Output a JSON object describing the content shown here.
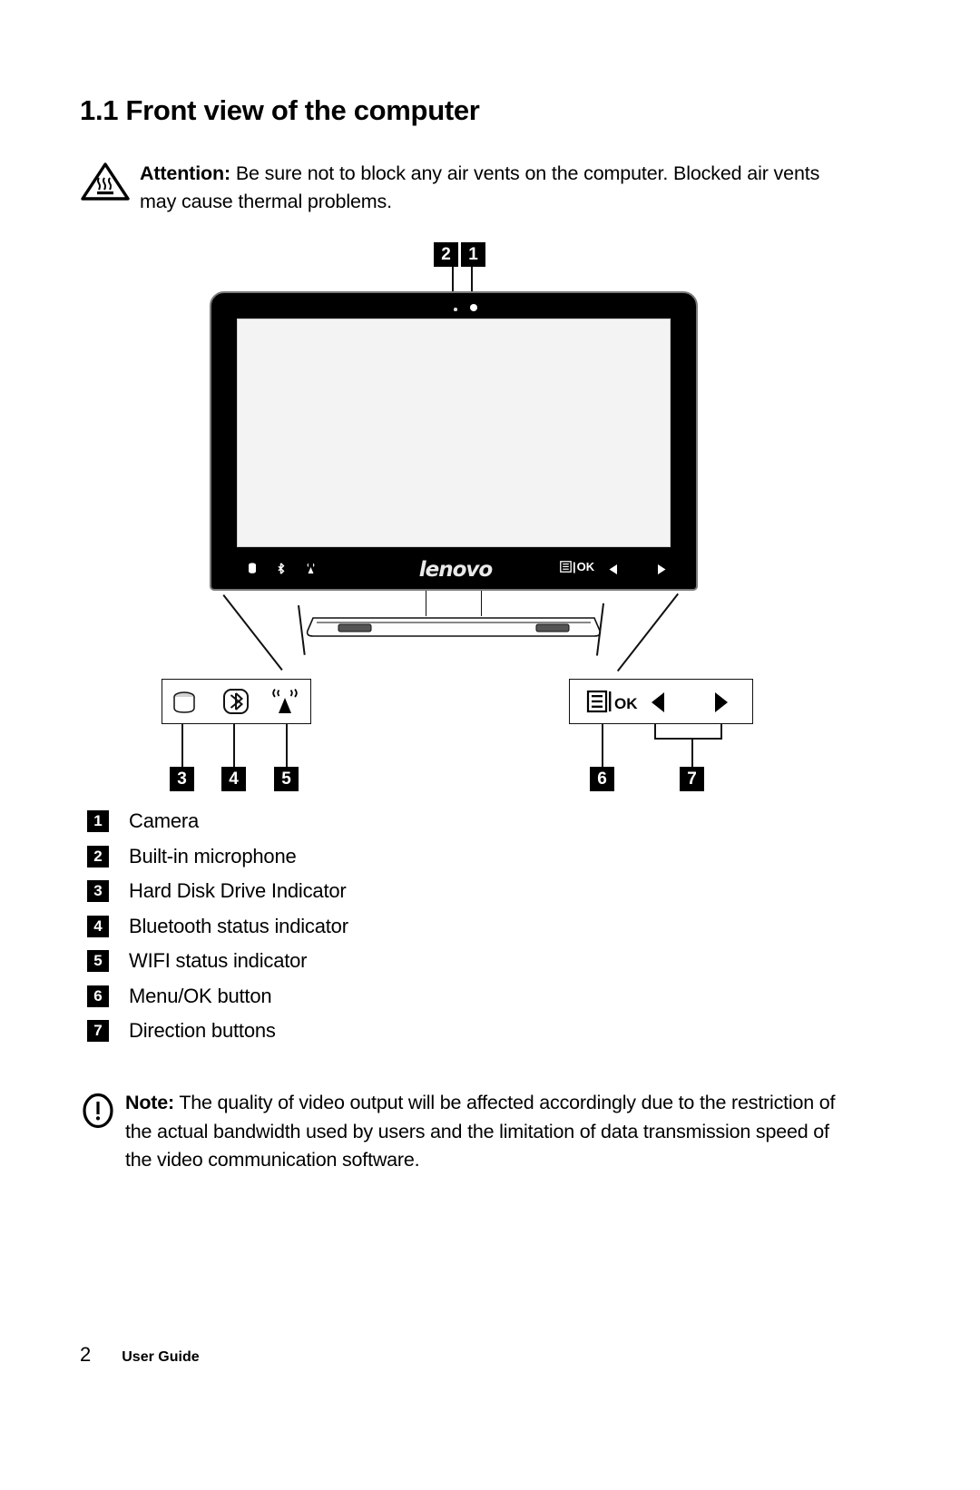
{
  "heading": "1.1 Front view of the computer",
  "attention": {
    "icon": "hot-surface-warning-icon",
    "label": "Attention:",
    "body": " Be sure not to block any air vents on the computer. Blocked air vents may cause thermal problems."
  },
  "diagram": {
    "brand_logo": "lenovo",
    "callouts": {
      "c1": "1",
      "c2": "2",
      "c3": "3",
      "c4": "4",
      "c5": "5",
      "c6": "6",
      "c7": "7"
    },
    "bezel": {
      "menu_ok_label": "OK",
      "icons": [
        "hard-disk-icon",
        "bluetooth-icon",
        "wifi-icon"
      ],
      "arrows": [
        "left-arrow-icon",
        "right-arrow-icon"
      ]
    },
    "detail_left_icons": [
      "hard-disk-icon",
      "bluetooth-icon",
      "wifi-icon"
    ],
    "detail_right": {
      "menu_ok_label": "OK",
      "arrows": [
        "left-arrow-icon",
        "right-arrow-icon"
      ]
    }
  },
  "legend": [
    {
      "num": "1",
      "label": "Camera"
    },
    {
      "num": "2",
      "label": "Built-in microphone"
    },
    {
      "num": "3",
      "label": "Hard Disk Drive Indicator"
    },
    {
      "num": "4",
      "label": "Bluetooth status indicator"
    },
    {
      "num": "5",
      "label": "WIFI status indicator"
    },
    {
      "num": "6",
      "label": "Menu/OK button"
    },
    {
      "num": "7",
      "label": "Direction buttons"
    }
  ],
  "note": {
    "icon": "exclamation-circle-icon",
    "label": "Note:",
    "body": " The quality of video output will be affected accordingly due to the restriction of the actual bandwidth used by users and the limitation of data transmission speed of the video communication software."
  },
  "footer": {
    "page_number": "2",
    "label": "User Guide"
  }
}
